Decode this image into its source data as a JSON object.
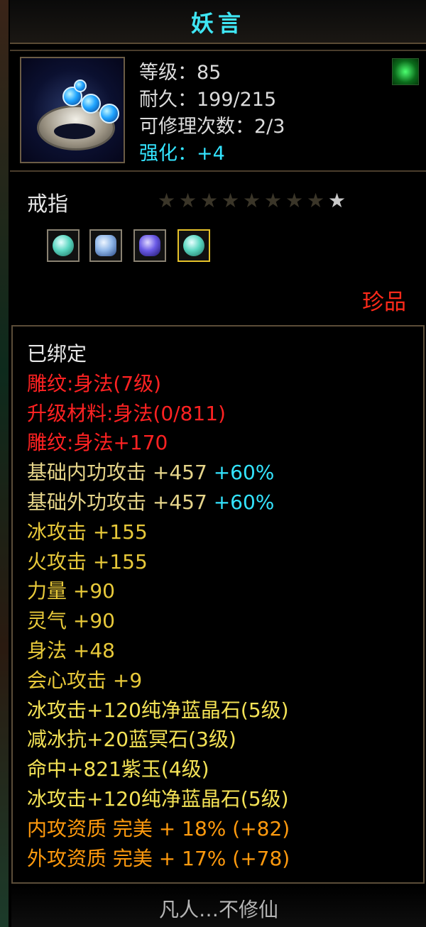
{
  "title": "妖言",
  "item": {
    "icon": "ring-icon",
    "stats": [
      {
        "text": "等级：85"
      },
      {
        "text": "耐久：199/215"
      },
      {
        "text": "可修理次数：2/3"
      },
      {
        "text": "强化：+4"
      }
    ],
    "corner_icon": "green-jade-icon",
    "type": "戒指",
    "stars_total": 9,
    "stars_lit": 1,
    "socket_gems": [
      "green-crystal-icon",
      "blue-sapphire-icon",
      "purple-gem-icon",
      "green-crystal-icon"
    ],
    "quality": "珍品"
  },
  "properties": [
    {
      "text": "已绑定",
      "color": "#e8e8e8"
    },
    {
      "text": "雕纹:身法(7级)",
      "color": "#ff2222"
    },
    {
      "text": "升级材料:身法(0/811)",
      "color": "#ff2222"
    },
    {
      "text": "雕纹:身法+170",
      "color": "#ff2222"
    },
    {
      "text": "基础内功攻击  +457",
      "extra": "+60%",
      "color": "#e6d58a"
    },
    {
      "text": "基础外功攻击  +457",
      "extra": "+60%",
      "color": "#e6d58a"
    },
    {
      "text": "冰攻击  +155",
      "color": "#e8c93a"
    },
    {
      "text": "火攻击  +155",
      "color": "#e8c93a"
    },
    {
      "text": "力量  +90",
      "color": "#e8c93a"
    },
    {
      "text": "灵气  +90",
      "color": "#e8c93a"
    },
    {
      "text": "身法  +48",
      "color": "#e8c93a"
    },
    {
      "text": "会心攻击  +9",
      "color": "#e8c93a"
    },
    {
      "text": "冰攻击+120纯净蓝晶石(5级)",
      "color": "#f4e256"
    },
    {
      "text": "减冰抗+20蓝冥石(3级)",
      "color": "#f4e256"
    },
    {
      "text": "命中+821紫玉(4级)",
      "color": "#f4e256"
    },
    {
      "text": "冰攻击+120纯净蓝晶石(5级)",
      "color": "#f4e256"
    },
    {
      "text": "内攻资质  完美  +  18%  (+82)",
      "color": "#ff9a0e"
    },
    {
      "text": "外攻资质  完美  +  17%  (+78)",
      "color": "#ff9a0e"
    }
  ],
  "footer": "凡人…不修仙"
}
